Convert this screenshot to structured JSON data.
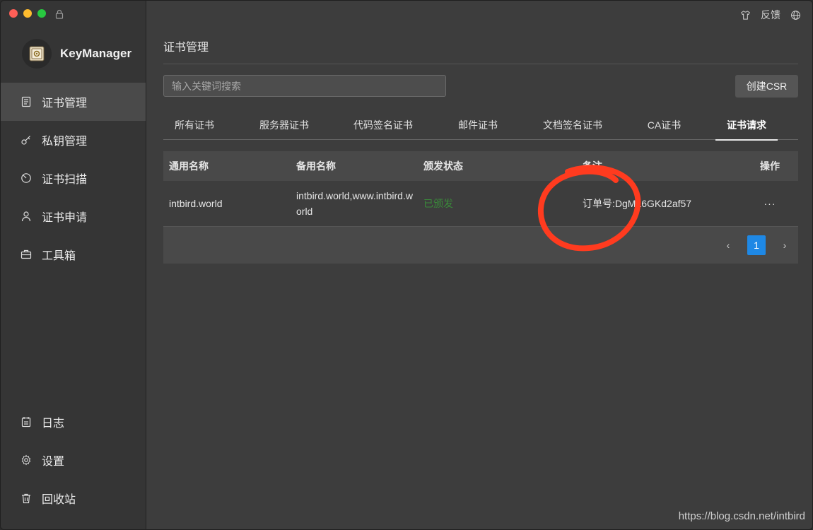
{
  "app": {
    "name": "KeyManager"
  },
  "topbar": {
    "feedback_label": "反馈"
  },
  "sidebar": {
    "items": [
      {
        "label": "证书管理",
        "icon": "certificate-icon",
        "active": true
      },
      {
        "label": "私钥管理",
        "icon": "key-icon",
        "active": false
      },
      {
        "label": "证书扫描",
        "icon": "scan-icon",
        "active": false
      },
      {
        "label": "证书申请",
        "icon": "user-icon",
        "active": false
      },
      {
        "label": "工具箱",
        "icon": "toolbox-icon",
        "active": false
      }
    ],
    "bottom_items": [
      {
        "label": "日志",
        "icon": "log-icon"
      },
      {
        "label": "设置",
        "icon": "gear-icon"
      },
      {
        "label": "回收站",
        "icon": "trash-icon"
      }
    ]
  },
  "main": {
    "title": "证书管理",
    "search_placeholder": "输入关键词搜索",
    "create_csr_label": "创建CSR",
    "tabs": [
      {
        "label": "所有证书",
        "active": false
      },
      {
        "label": "服务器证书",
        "active": false
      },
      {
        "label": "代码签名证书",
        "active": false
      },
      {
        "label": "邮件证书",
        "active": false
      },
      {
        "label": "文档签名证书",
        "active": false
      },
      {
        "label": "CA证书",
        "active": false
      },
      {
        "label": "证书请求",
        "active": true
      }
    ],
    "table": {
      "headers": [
        "通用名称",
        "备用名称",
        "颁发状态",
        "备注",
        "操作"
      ],
      "rows": [
        {
          "common_name": "intbird.world",
          "alt_names": "intbird.world,www.intbird.world",
          "status": "已颁发",
          "note": "订单号:DgML6GKd2af57",
          "action": "···"
        }
      ]
    },
    "pagination": {
      "current_page": "1",
      "prev": "‹",
      "next": "›"
    }
  },
  "colors": {
    "accent": "#1e88e5",
    "status_ok": "#3a8a3a",
    "annotation": "#ff3b1f"
  },
  "watermark": "https://blog.csdn.net/intbird"
}
